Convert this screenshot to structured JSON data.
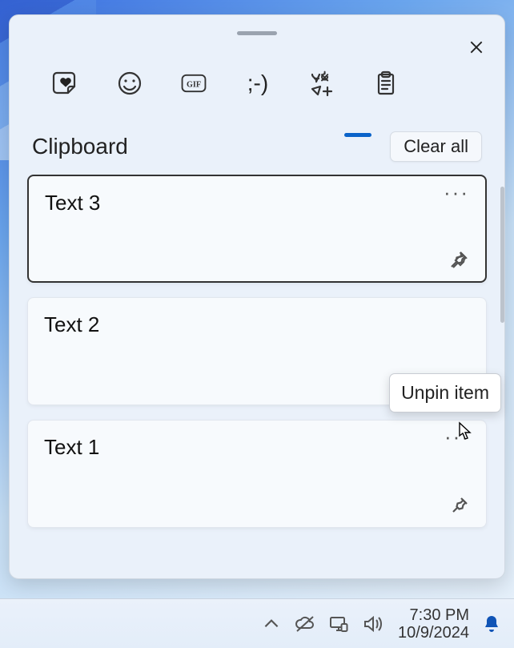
{
  "flyout": {
    "title": "Clipboard",
    "clear_label": "Clear all",
    "tabs": {
      "kaomoji": ";-)"
    },
    "items": [
      {
        "text": "Text 3",
        "pinned": false,
        "focused": true
      },
      {
        "text": "Text 2",
        "pinned": true,
        "focused": false
      },
      {
        "text": "Text 1",
        "pinned": false,
        "focused": false
      }
    ],
    "tooltip": "Unpin item"
  },
  "taskbar": {
    "time": "7:30 PM",
    "date": "10/9/2024"
  }
}
